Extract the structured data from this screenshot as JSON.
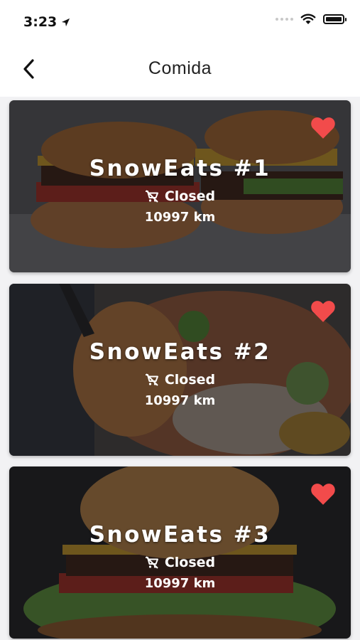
{
  "status_bar": {
    "time": "3:23"
  },
  "navbar": {
    "title": "Comida"
  },
  "colors": {
    "heart": "#f24b4b",
    "text": "#ffffff",
    "overlay": "#0a0a0c"
  },
  "restaurants": [
    {
      "name": "SnowEats #1",
      "status": "Closed",
      "distance": "10997 km",
      "favorite": true,
      "image": "burgers-icon"
    },
    {
      "name": "SnowEats #2",
      "status": "Closed",
      "distance": "10997 km",
      "favorite": true,
      "image": "pasta-icon"
    },
    {
      "name": "SnowEats #3",
      "status": "Closed",
      "distance": "10997 km",
      "favorite": true,
      "image": "burger-icon"
    }
  ]
}
